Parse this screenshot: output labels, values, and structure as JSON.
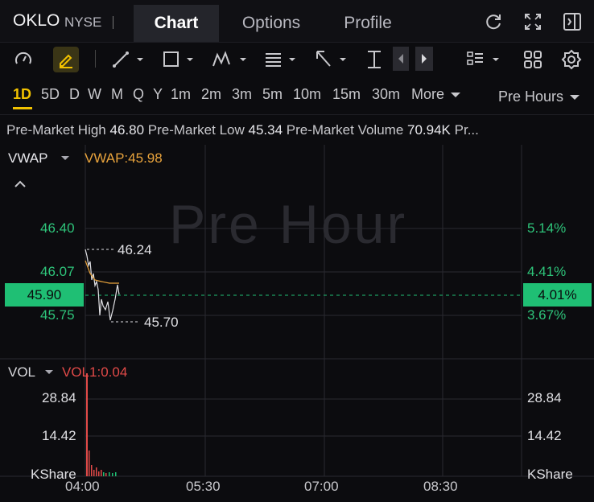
{
  "header": {
    "ticker": "OKLO",
    "exchange": "NYSE",
    "tabs": [
      "Chart",
      "Options",
      "Profile"
    ],
    "active_tab": "Chart"
  },
  "toolbar": {
    "icons": [
      "gauge-icon",
      "pen-icon",
      "trendline-icon",
      "rectangle-icon",
      "pattern-icon",
      "fib-icon",
      "arrow-icon",
      "measure-icon",
      "prev-icon",
      "next-icon",
      "layout-list-icon",
      "grid-icon",
      "settings-icon"
    ]
  },
  "periods": [
    "1D",
    "5D",
    "D",
    "W",
    "M",
    "Q",
    "Y",
    "1m",
    "2m",
    "3m",
    "5m",
    "10m",
    "15m",
    "30m"
  ],
  "active_period": "1D",
  "more_label": "More",
  "session_label": "Pre Hours",
  "premarket": {
    "high_label": "Pre-Market High",
    "high": "46.80",
    "low_label": "Pre-Market Low",
    "low": "45.34",
    "volume_label": "Pre-Market Volume",
    "volume": "70.94K",
    "overflow": "Pr..."
  },
  "price_chart": {
    "indicator": "VWAP",
    "indicator_value": "VWAP:45.98",
    "watermark": "Pre Hour",
    "y_ticks": [
      "46.40",
      "46.07",
      "45.75"
    ],
    "pct_ticks": [
      "5.14%",
      "4.41%",
      "3.67%"
    ],
    "current_price": "45.90",
    "current_pct": "4.01%",
    "high_label": "46.24",
    "low_label": "45.70"
  },
  "volume_chart": {
    "indicator": "VOL",
    "indicator_value": "VOL1:0.04",
    "y_ticks": [
      "28.84",
      "14.42"
    ],
    "unit": "KShare"
  },
  "x_ticks": [
    "04:00",
    "05:30",
    "07:00",
    "08:30"
  ],
  "colors": {
    "up": "#1fbf74",
    "down": "#e24a48",
    "vwap": "#e8a33c",
    "accent": "#f2c200"
  }
}
